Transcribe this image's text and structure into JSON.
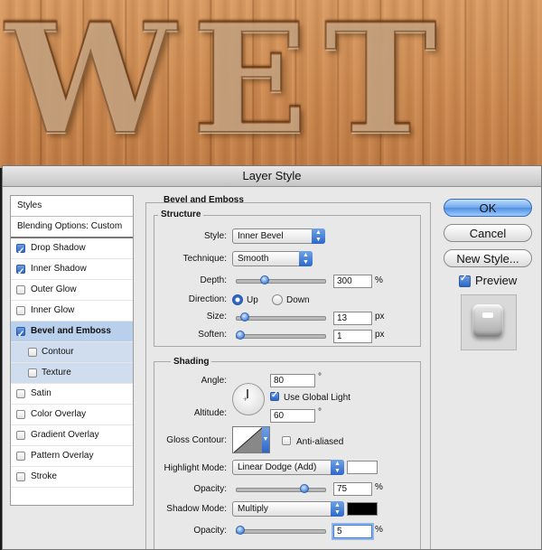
{
  "background": {
    "wet_text": "WET"
  },
  "dialog": {
    "title": "Layer Style",
    "styles_list": {
      "header": "Styles",
      "blending": "Blending Options: Custom",
      "items": [
        {
          "label": "Drop Shadow",
          "checked": true
        },
        {
          "label": "Inner Shadow",
          "checked": true
        },
        {
          "label": "Outer Glow",
          "checked": false
        },
        {
          "label": "Inner Glow",
          "checked": false
        },
        {
          "label": "Bevel and Emboss",
          "checked": true,
          "selected": true
        },
        {
          "label": "Contour",
          "checked": false,
          "sub": true
        },
        {
          "label": "Texture",
          "checked": false,
          "sub": true
        },
        {
          "label": "Satin",
          "checked": false
        },
        {
          "label": "Color Overlay",
          "checked": false
        },
        {
          "label": "Gradient Overlay",
          "checked": false
        },
        {
          "label": "Pattern Overlay",
          "checked": false
        },
        {
          "label": "Stroke",
          "checked": false
        }
      ]
    },
    "bevel": {
      "title": "Bevel and Emboss",
      "structure": {
        "title": "Structure",
        "style_label": "Style:",
        "style_value": "Inner Bevel",
        "technique_label": "Technique:",
        "technique_value": "Smooth",
        "depth_label": "Depth:",
        "depth_value": "300",
        "depth_unit": "%",
        "direction_label": "Direction:",
        "up_label": "Up",
        "down_label": "Down",
        "direction_selected": "Up",
        "size_label": "Size:",
        "size_value": "13",
        "size_unit": "px",
        "soften_label": "Soften:",
        "soften_value": "1",
        "soften_unit": "px"
      },
      "shading": {
        "title": "Shading",
        "angle_label": "Angle:",
        "angle_value": "80",
        "angle_unit": "°",
        "global_light_label": "Use Global Light",
        "global_light_checked": true,
        "altitude_label": "Altitude:",
        "altitude_value": "60",
        "altitude_unit": "°",
        "gloss_label": "Gloss Contour:",
        "anti_aliased_label": "Anti-aliased",
        "anti_aliased_checked": false,
        "highlight_mode_label": "Highlight Mode:",
        "highlight_mode_value": "Linear Dodge (Add)",
        "highlight_color": "#ffffff",
        "highlight_opacity_label": "Opacity:",
        "highlight_opacity_value": "75",
        "highlight_opacity_unit": "%",
        "shadow_mode_label": "Shadow Mode:",
        "shadow_mode_value": "Multiply",
        "shadow_color": "#000000",
        "shadow_opacity_label": "Opacity:",
        "shadow_opacity_value": "5",
        "shadow_opacity_unit": "%"
      }
    },
    "buttons": {
      "ok": "OK",
      "cancel": "Cancel",
      "new_style": "New Style...",
      "preview_label": "Preview",
      "preview_checked": true
    }
  }
}
